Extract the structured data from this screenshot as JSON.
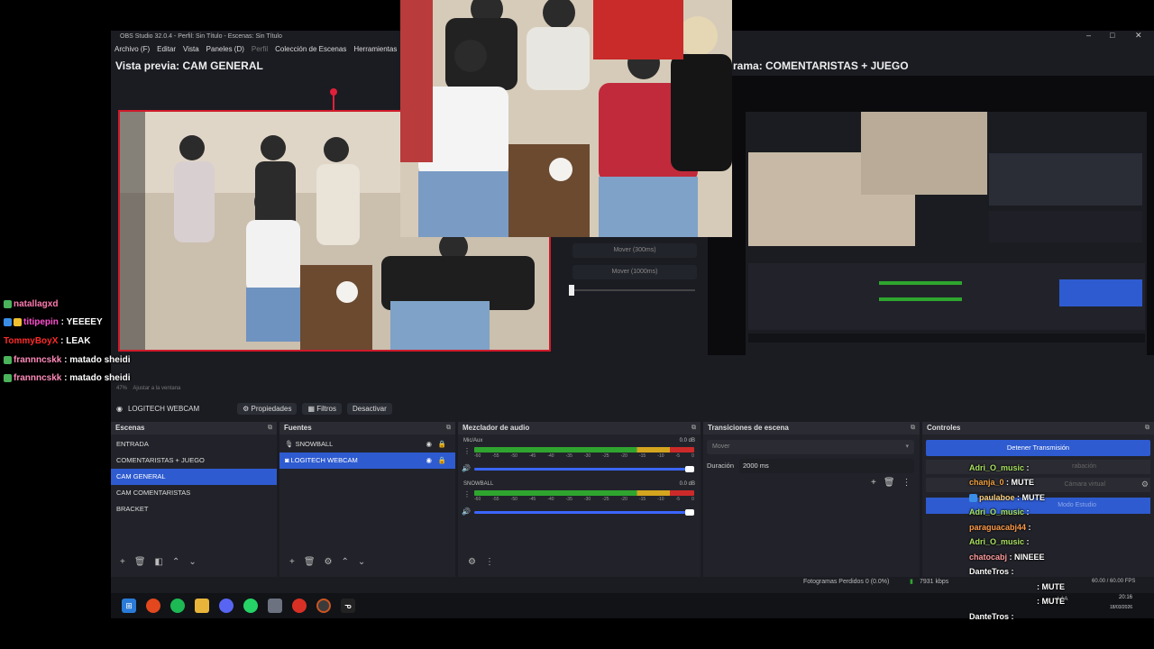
{
  "window": {
    "title": "OBS Studio 32.0.4 - Perfil: Sin Título - Escenas: Sin Título",
    "minimize": "–",
    "maximize": "□",
    "close": "✕"
  },
  "menu": [
    "Archivo (F)",
    "Editar",
    "Vista",
    "Paneles (D)",
    "Perfil",
    "Colección de Escenas",
    "Herramientas"
  ],
  "preview": {
    "title": "Vista previa: CAM GENERAL"
  },
  "program": {
    "title": "rama: COMENTARISTAS + JUEGO"
  },
  "move_controls": [
    "Mover (300ms)",
    "Mover (1000ms)"
  ],
  "source_toolbar": {
    "zoom": "47%",
    "fit": "Ajustar a la ventana",
    "source_name": "LOGITECH WEBCAM",
    "properties": "Propiedades",
    "filters": "Filtros",
    "deactivate": "Desactivar"
  },
  "scenes": {
    "header": "Escenas",
    "items": [
      "ENTRADA",
      "COMENTARISTAS + JUEGO",
      "CAM GENERAL",
      "CAM COMENTARISTAS",
      "BRACKET"
    ],
    "selected_index": 2
  },
  "sources": {
    "header": "Fuentes",
    "items": [
      "SNOWBALL",
      "LOGITECH WEBCAM"
    ],
    "selected_index": 1
  },
  "mixer": {
    "header": "Mezclador de audio",
    "channels": [
      {
        "name": "Mic/Aux",
        "db": "0.0 dB",
        "volume": 0.99
      },
      {
        "name": "SNOWBALL",
        "db": "0.0 dB",
        "volume": 0.99
      }
    ],
    "scale": [
      "-60",
      "-55",
      "-50",
      "-45",
      "-40",
      "-35",
      "-30",
      "-25",
      "-20",
      "-15",
      "-10",
      "-5",
      "0"
    ]
  },
  "transitions": {
    "header": "Transiciones de escena",
    "type": "Mover",
    "duration_label": "Duración",
    "duration_value": "2000 ms"
  },
  "controls": {
    "header": "Controles",
    "stop_stream": "Detener Transmisión",
    "ghost_1": "rabación",
    "ghost_2": "Cámara virtual",
    "ghost_3": "Modo Estudio"
  },
  "status": {
    "dropped": "Fotogramas Perdidos 0 (0.0%)",
    "bitrate": "7931 kbps",
    "fps": "60.00 / 60.00 FPS"
  },
  "taskbar": {
    "time": "20:16",
    "date": "18/03/2026",
    "lang": "LAA"
  },
  "chat_left": [
    {
      "user": "natallagxd",
      "msg": "",
      "color": "#ff7ab0"
    },
    {
      "user": "titipepin",
      "msg": "YEEEEY",
      "color": "#ff4fd0"
    },
    {
      "user": "TommyBoyX",
      "msg": "LEAK",
      "color": "#ff2a2a"
    },
    {
      "user": "frannncskk",
      "msg": "matado sheidi",
      "color": "#ff8ab8"
    },
    {
      "user": "frannncskk",
      "msg": "matado sheidi",
      "color": "#ff8ab8"
    }
  ],
  "chat_right": [
    {
      "user": "Adri_O_music",
      "msg": "",
      "color": "#a8e060"
    },
    {
      "user": "chanja_0",
      "msg": "MUTE",
      "color": "#f0a040"
    },
    {
      "user": "paulaboe",
      "msg": "MUTE",
      "color": "#ffd27a"
    },
    {
      "user": "Adri_O_music",
      "msg": "",
      "color": "#a8e060"
    },
    {
      "user": "paraguacabj44",
      "msg": "",
      "color": "#ff9c4a"
    },
    {
      "user": "Adri_O_music",
      "msg": "",
      "color": "#a8e060"
    },
    {
      "user": "chatocabj",
      "msg": "NINEEE",
      "color": "#ff9c9c"
    },
    {
      "user": "DanteTros",
      "msg": "",
      "color": "#ffffff"
    },
    {
      "user": "",
      "msg": "MUTE",
      "color": "#ffffff"
    },
    {
      "user": "",
      "msg": "MUTE",
      "color": "#ffffff"
    },
    {
      "user": "DanteTros",
      "msg": "",
      "color": "#ffffff"
    }
  ],
  "colors": {
    "accent": "#2e5bd0",
    "preview_border": "#d01a2a",
    "meter_green": "#2fa52f",
    "meter_yellow": "#d4a51e",
    "meter_red": "#cc2a2a"
  }
}
